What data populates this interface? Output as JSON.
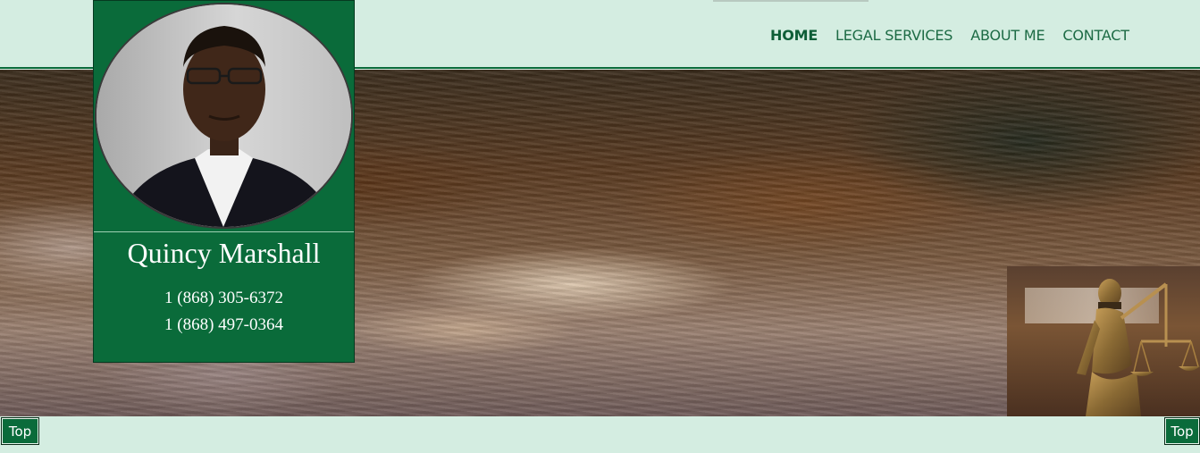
{
  "header": {
    "nav": [
      {
        "label": "HOME",
        "active": true
      },
      {
        "label": "LEGAL SERVICES",
        "active": false
      },
      {
        "label": "ABOUT ME",
        "active": false
      },
      {
        "label": "CONTACT",
        "active": false
      }
    ]
  },
  "profile": {
    "name": "Quincy Marshall",
    "phones": [
      "1 (868) 305-6372",
      "1 (868) 497-0364"
    ]
  },
  "scroll_to_top": {
    "left_label": "Top",
    "right_label": "Top"
  },
  "colors": {
    "brand_green": "#0a6b3a",
    "page_background": "#d4ede1",
    "nav_text": "#1d6b45"
  },
  "icons": {
    "portrait": "person-photo",
    "justice": "lady-justice-statue"
  }
}
